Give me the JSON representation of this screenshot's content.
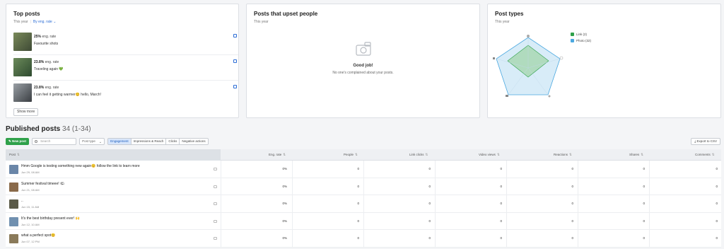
{
  "top_posts": {
    "title": "Top posts",
    "period": "This year",
    "sort": "By eng. rate",
    "sort_icon": "chevron-down-icon",
    "items": [
      {
        "rate": "25%",
        "rate_label": " eng. rate",
        "text": "Favourite shots",
        "thumb_color": "#5b6b4a"
      },
      {
        "rate": "23.8%",
        "rate_label": " eng. rate",
        "text": "Traveling again 💚",
        "thumb_color": "#4b6b3f"
      },
      {
        "rate": "23.8%",
        "rate_label": " eng. rate",
        "text": "I can feel it getting warmer😊 hello, March!",
        "thumb_color": "#6a6e72"
      }
    ],
    "show_more": "Show more"
  },
  "upset": {
    "title": "Posts that upset people",
    "period": "This year",
    "good_job": "Good job!",
    "desc": "No one's complained about your posts."
  },
  "post_types": {
    "title": "Post types",
    "period": "This year",
    "legend": [
      {
        "label": "Link (2)",
        "color": "#2fa14a"
      },
      {
        "label": "Photo (32)",
        "color": "#4aa8e0"
      }
    ]
  },
  "published": {
    "title": "Published posts",
    "count": "34 (1-34)",
    "new_post": "New post",
    "search_placeholder": "Search",
    "post_type": "Post type",
    "tabs": [
      "Engagement",
      "Impressions & Reach",
      "Clicks",
      "Negative actions"
    ],
    "active_tab": 0,
    "export": "Export to CSV",
    "columns": [
      "Post",
      "Eng. rate",
      "People",
      "Link clicks",
      "Video views",
      "Reactions",
      "Shares",
      "Comments"
    ],
    "rows": [
      {
        "text": "Hmm Google is testing something new again😊 follow the link to learn more",
        "date": "Jun 29, 08 AM",
        "values": [
          "0%",
          "0",
          "0",
          "0",
          "0",
          "0",
          "0"
        ],
        "thumb_color": "#6a86a8",
        "type_icon": "link-icon"
      },
      {
        "text": "Summer festival timeee! 🌤",
        "date": "Jun 21, 08 AM",
        "values": [
          "0%",
          "0",
          "0",
          "0",
          "0",
          "0",
          "0"
        ],
        "thumb_color": "#8a6a4a",
        "type_icon": "photo-icon"
      },
      {
        "text": "..",
        "date": "Jun 15, 11 AM",
        "values": [
          "0%",
          "0",
          "0",
          "0",
          "0",
          "0",
          "0"
        ],
        "thumb_color": "#5a5a48",
        "type_icon": "photo-icon"
      },
      {
        "text": "It's the best birthday present ever! 🙌",
        "date": "Jun 12, 10 AM",
        "values": [
          "0%",
          "0",
          "0",
          "0",
          "0",
          "0",
          "0"
        ],
        "thumb_color": "#7090b0",
        "type_icon": "photo-icon"
      },
      {
        "text": "what a perfect spot😊",
        "date": "Jun 07, 12 PM",
        "values": [
          "0%",
          "0",
          "0",
          "0",
          "0",
          "0",
          "0"
        ],
        "thumb_color": "#8a7a5a",
        "type_icon": "photo-icon"
      }
    ]
  }
}
